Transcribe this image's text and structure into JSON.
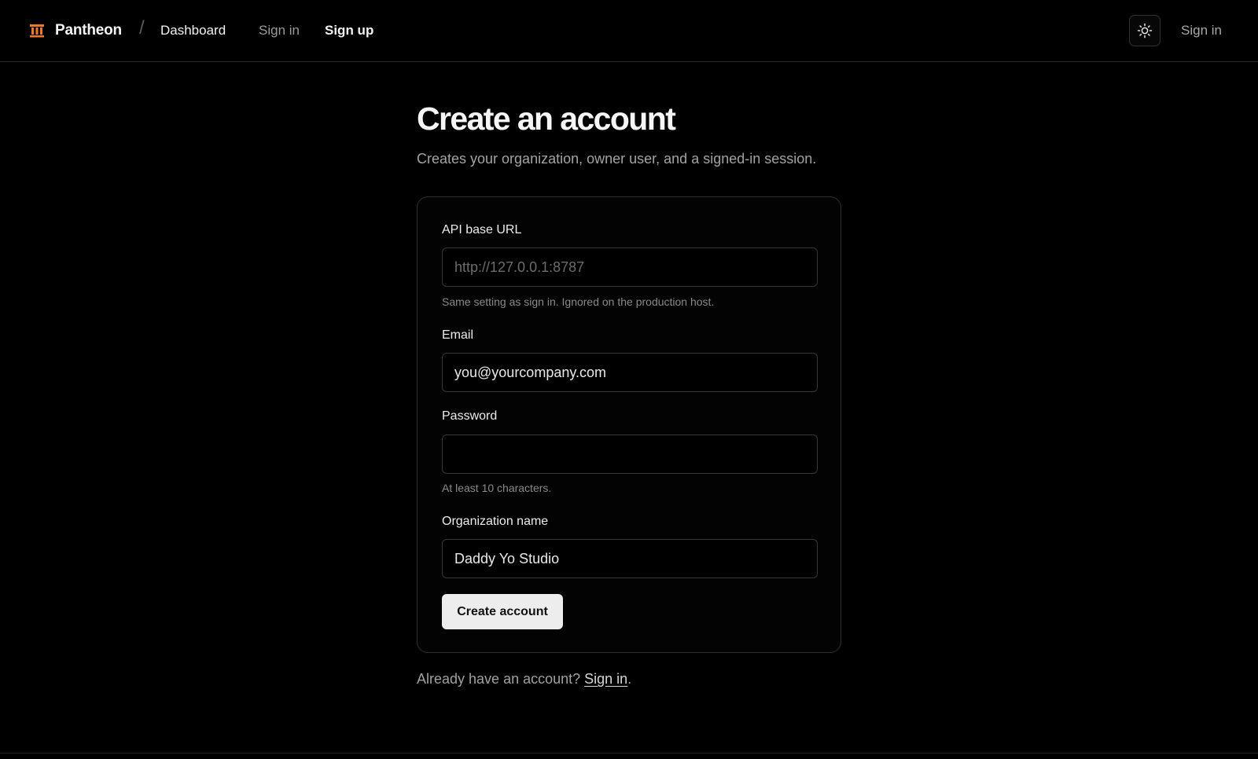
{
  "colors": {
    "background": "#000000",
    "brand_accent": "#f0782a",
    "primary_button_bg": "#ededed"
  },
  "header": {
    "brand_name": "Pantheon",
    "brand_icon": "pillars-icon",
    "breadcrumb_separator": "/",
    "breadcrumb_current": "Dashboard",
    "nav": {
      "sign_in": "Sign in",
      "sign_up": "Sign up"
    },
    "theme_toggle_icon": "sun-icon",
    "right_sign_in": "Sign in"
  },
  "main": {
    "title": "Create an account",
    "subtitle": "Creates your organization, owner user, and a signed-in session."
  },
  "form": {
    "api_base_url": {
      "label": "API base URL",
      "value": "",
      "placeholder": "http://127.0.0.1:8787",
      "hint": "Same setting as sign in. Ignored on the production host."
    },
    "email": {
      "label": "Email",
      "value": "you@yourcompany.com",
      "placeholder": ""
    },
    "password": {
      "label": "Password",
      "value": "",
      "hint": "At least 10 characters."
    },
    "organization_name": {
      "label": "Organization name",
      "value": "Daddy Yo Studio"
    },
    "submit_label": "Create account"
  },
  "footer": {
    "prompt": "Already have an account? ",
    "link_text": "Sign in",
    "suffix": "."
  }
}
